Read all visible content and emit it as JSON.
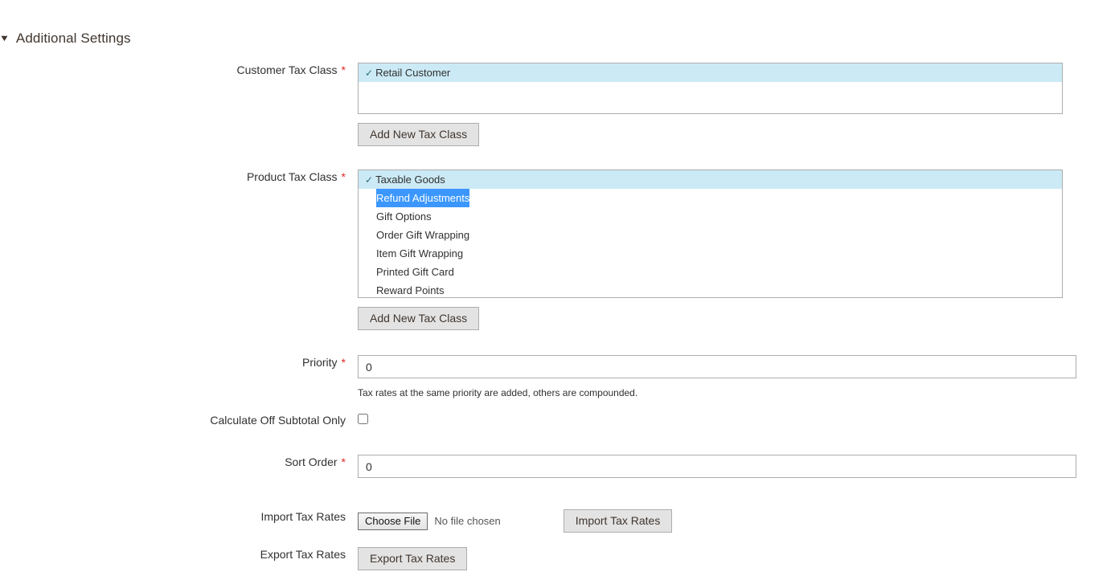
{
  "section": {
    "caret_icon": "triangle-down-icon",
    "title": "Additional Settings"
  },
  "fields": {
    "customer_tax_class": {
      "label": "Customer Tax Class",
      "required_marker": "*",
      "options": [
        {
          "label": "Retail Customer",
          "checked": true,
          "text_selected": false
        }
      ],
      "add_button_label": "Add New Tax Class"
    },
    "product_tax_class": {
      "label": "Product Tax Class",
      "required_marker": "*",
      "options": [
        {
          "label": "Taxable Goods",
          "checked": true,
          "text_selected": false
        },
        {
          "label": "Refund Adjustments",
          "checked": false,
          "text_selected": true
        },
        {
          "label": "Gift Options",
          "checked": false,
          "text_selected": false
        },
        {
          "label": "Order Gift Wrapping",
          "checked": false,
          "text_selected": false
        },
        {
          "label": "Item Gift Wrapping",
          "checked": false,
          "text_selected": false
        },
        {
          "label": "Printed Gift Card",
          "checked": false,
          "text_selected": false
        },
        {
          "label": "Reward Points",
          "checked": false,
          "text_selected": false
        }
      ],
      "add_button_label": "Add New Tax Class"
    },
    "priority": {
      "label": "Priority",
      "required_marker": "*",
      "value": "0",
      "placeholder": "",
      "note": "Tax rates at the same priority are added, others are compounded."
    },
    "calculate_off_subtotal_only": {
      "label": "Calculate Off Subtotal Only",
      "checked": false
    },
    "sort_order": {
      "label": "Sort Order",
      "required_marker": "*",
      "value": "0",
      "placeholder": ""
    },
    "import_tax_rates": {
      "label": "Import Tax Rates",
      "choose_file_label": "Choose File",
      "no_file_text": "No file chosen",
      "import_button_label": "Import Tax Rates"
    },
    "export_tax_rates": {
      "label": "Export Tax Rates",
      "export_button_label": "Export Tax Rates"
    }
  },
  "colors": {
    "selected_option_bg": "#cbeaf5",
    "text_selection_bg": "#3b97fd",
    "required_asterisk": "#e22626",
    "label_text": "#303030",
    "button_bg": "#e3e3e3",
    "border": "#adadad"
  }
}
